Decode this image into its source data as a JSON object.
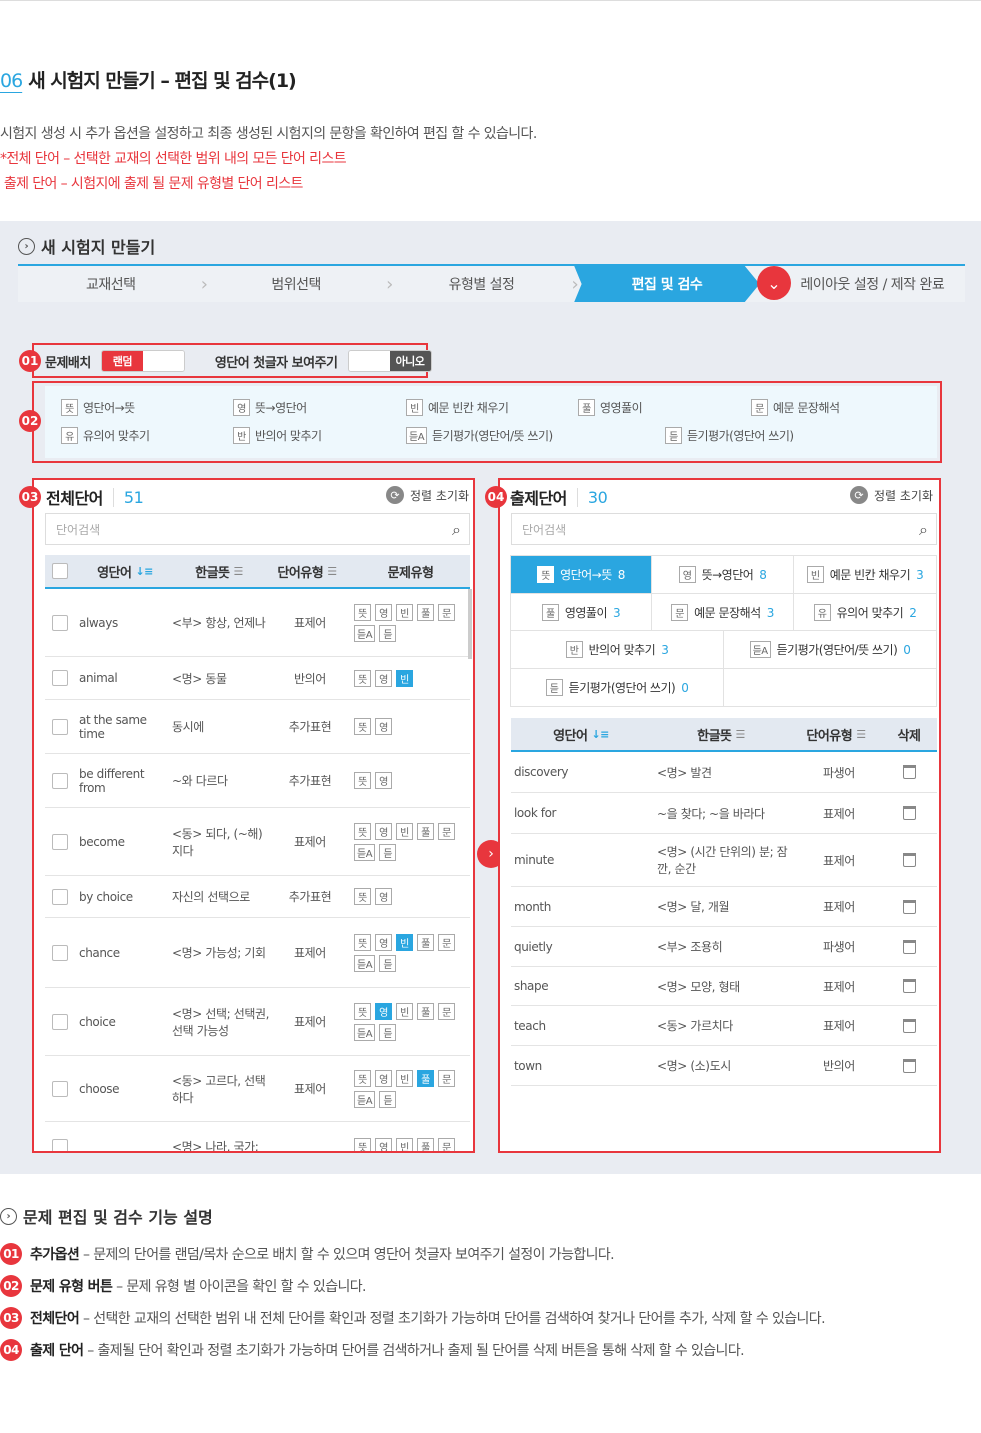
{
  "section": {
    "number": "06",
    "title": "새 시험지 만들기 – 편집 및 검수(1)"
  },
  "description": {
    "line1": "시험지 생성 시 추가 옵션을 설정하고 최종 생성된 시험지의 문항을 확인하여 편집 할 수 있습니다.",
    "line2": "*전체 단어 – 선택한 교재의 선택한 범위 내의 모든 단어 리스트",
    "line3": " 출제 단어 – 시험지에 출제 될 문제 유형별 단어 리스트"
  },
  "panel": {
    "title": "새 시험지 만들기",
    "steps": [
      "교재선택",
      "범위선택",
      "유형별 설정",
      "편집 및 검수",
      "레이아웃 설정 / 제작 완료"
    ]
  },
  "options": {
    "badge": "01",
    "placement_label": "문제배치",
    "placement_value": "랜덤",
    "first_letter_label": "영단어 첫글자 보여주기",
    "first_letter_value": "아니오"
  },
  "types": {
    "badge": "02",
    "items": [
      {
        "icon": "뜻",
        "label": "영단어→뜻"
      },
      {
        "icon": "영",
        "label": "뜻→영단어"
      },
      {
        "icon": "빈",
        "label": "예문 빈칸 채우기"
      },
      {
        "icon": "풀",
        "label": "영영풀이"
      },
      {
        "icon": "문",
        "label": "예문 문장해석"
      },
      {
        "icon": "유",
        "label": "유의어 맞추기"
      },
      {
        "icon": "반",
        "label": "반의어 맞추기"
      },
      {
        "icon": "듣A",
        "label": "듣기평가(영단어/뜻 쓰기)"
      },
      {
        "icon": "듣",
        "label": "듣기평가(영단어 쓰기)"
      }
    ]
  },
  "all_words": {
    "badge": "03",
    "title": "전체단어",
    "count": "51",
    "reset": "정렬 초기화",
    "search_placeholder": "단어검색",
    "columns": [
      "영단어",
      "한글뜻",
      "단어유형",
      "문제유형"
    ],
    "rows": [
      {
        "en": "always",
        "ko": "<부> 항상, 언제나",
        "type": "표제어"
      },
      {
        "en": "animal",
        "ko": "<명> 동물",
        "type": "반의어"
      },
      {
        "en": "at the same time",
        "ko": "동시에",
        "type": "추가표현"
      },
      {
        "en": "be different from",
        "ko": "~와 다르다",
        "type": "추가표현"
      },
      {
        "en": "become",
        "ko": "<동> 되다, (~해) 지다",
        "type": "표제어"
      },
      {
        "en": "by choice",
        "ko": "자신의 선택으로",
        "type": "추가표현"
      },
      {
        "en": "chance",
        "ko": "<명> 가능성; 기회",
        "type": "표제어"
      },
      {
        "en": "choice",
        "ko": "<명> 선택; 선택권, 선택 가능성",
        "type": "표제어"
      },
      {
        "en": "choose",
        "ko": "<동> 고르다, 선택하다",
        "type": "표제어"
      },
      {
        "en": "",
        "ko": "<명> 나라, 국가;",
        "type": ""
      }
    ]
  },
  "exam_words": {
    "badge": "04",
    "title": "출제단어",
    "count": "30",
    "reset": "정렬 초기화",
    "search_placeholder": "단어검색",
    "tabs": [
      {
        "icon": "뜻",
        "label": "영단어→뜻",
        "n": "8"
      },
      {
        "icon": "영",
        "label": "뜻→영단어",
        "n": "8"
      },
      {
        "icon": "빈",
        "label": "예문 빈칸 채우기",
        "n": "3"
      },
      {
        "icon": "풀",
        "label": "영영풀이",
        "n": "3"
      },
      {
        "icon": "문",
        "label": "예문 문장해석",
        "n": "3"
      },
      {
        "icon": "유",
        "label": "유의어 맞추기",
        "n": "2"
      },
      {
        "icon": "반",
        "label": "반의어 맞추기",
        "n": "3"
      },
      {
        "icon": "듣A",
        "label": "듣기평가(영단어/뜻 쓰기)",
        "n": "0"
      },
      {
        "icon": "듣",
        "label": "듣기평가(영단어 쓰기)",
        "n": "0"
      }
    ],
    "columns": [
      "영단어",
      "한글뜻",
      "단어유형",
      "삭제"
    ],
    "rows": [
      {
        "en": "discovery",
        "ko": "<명> 발견",
        "type": "파생어"
      },
      {
        "en": "look for",
        "ko": "~을 찾다; ~을 바라다",
        "type": "표제어"
      },
      {
        "en": "minute",
        "ko": "<명> (시간 단위의) 분; 잠깐, 순간",
        "type": "표제어"
      },
      {
        "en": "month",
        "ko": "<명> 달, 개월",
        "type": "표제어"
      },
      {
        "en": "quietly",
        "ko": "<부> 조용히",
        "type": "파생어"
      },
      {
        "en": "shape",
        "ko": "<명> 모양, 형태",
        "type": "표제어"
      },
      {
        "en": "teach",
        "ko": "<동> 가르치다",
        "type": "표제어"
      },
      {
        "en": "town",
        "ko": "<명> (소)도시",
        "type": "반의어"
      }
    ]
  },
  "explain": {
    "title": "문제 편집 및 검수 기능 설명",
    "items": [
      {
        "badge": "01",
        "bold": "추가옵션",
        "text": " – 문제의 단어를 랜덤/목차 순으로 배치 할 수 있으며 영단어 첫글자 보여주기 설정이 가능합니다."
      },
      {
        "badge": "02",
        "bold": "문제 유형 버튼",
        "text": " – 문제 유형 별 아이콘을 확인 할 수 있습니다."
      },
      {
        "badge": "03",
        "bold": "전체단어",
        "text": " – 선택한 교재의 선택한 범위 내 전체 단어를 확인과 정렬 초기화가 가능하며 단어를 검색하여 찾거나 단어를 추가, 삭제 할 수 있습니다."
      },
      {
        "badge": "04",
        "bold": "출제 단어",
        "text": " – 출제될 단어 확인과 정렬 초기화가 가능하며 단어를 검색하거나 출제 될 단어를 삭제 버튼을 통해 삭제 할 수 있습니다."
      }
    ]
  },
  "colors": {
    "accent": "#2aa6e0",
    "red": "#e8363d"
  }
}
